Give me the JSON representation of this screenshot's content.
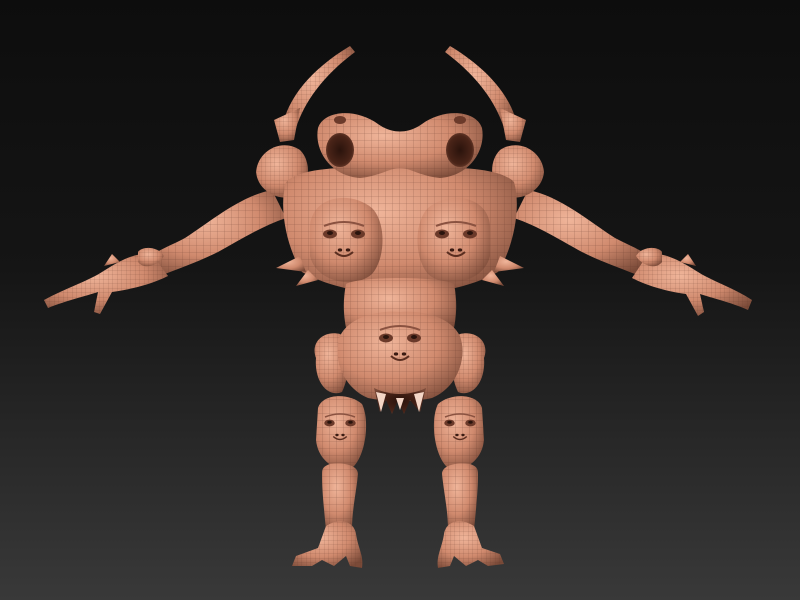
{
  "viewport": {
    "content": "3d-sculpt-mesh",
    "background_top": "#0d0d0d",
    "background_bottom": "#393939",
    "material_color": "#d08a6e",
    "material_highlight": "#f0b59a",
    "material_shadow": "#7a4a38",
    "wire_color": "#5a3326",
    "wireframe": true
  }
}
